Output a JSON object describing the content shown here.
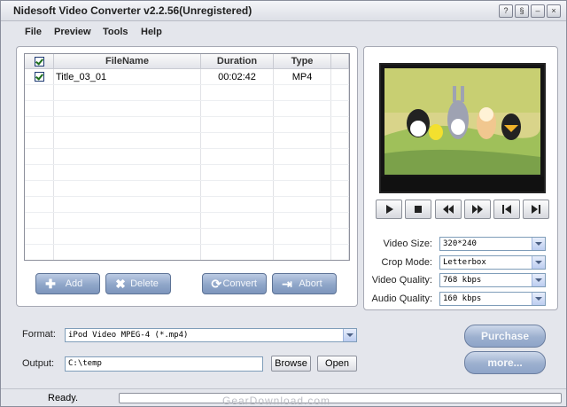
{
  "window": {
    "title": "Nidesoft Video Converter v2.2.56(Unregistered)"
  },
  "menu": [
    "File",
    "Preview",
    "Tools",
    "Help"
  ],
  "list": {
    "headers": {
      "filename": "FileName",
      "duration": "Duration",
      "type": "Type"
    },
    "rows": [
      {
        "checked": true,
        "filename": "Title_03_01",
        "duration": "00:02:42",
        "type": "MP4"
      }
    ]
  },
  "buttons": {
    "add": "Add",
    "delete": "Delete",
    "convert": "Convert",
    "abort": "Abort",
    "browse": "Browse",
    "open": "Open",
    "purchase": "Purchase",
    "more": "more..."
  },
  "settings": {
    "video_size": {
      "label": "Video Size:",
      "value": "320*240"
    },
    "crop_mode": {
      "label": "Crop Mode:",
      "value": "Letterbox"
    },
    "video_quality": {
      "label": "Video Quality:",
      "value": "768 kbps"
    },
    "audio_quality": {
      "label": "Audio Quality:",
      "value": "160 kbps"
    }
  },
  "format": {
    "label": "Format:",
    "value": "iPod Video MPEG-4 (*.mp4)"
  },
  "output": {
    "label": "Output:",
    "value": "C:\\temp"
  },
  "status": {
    "text": "Ready.",
    "progress": 0
  },
  "watermark": "GearDownload.com",
  "colors": {
    "button_blue": "#8fa6c9",
    "panel_bg": "#ffffff",
    "window_bg": "#e4e6ec"
  }
}
